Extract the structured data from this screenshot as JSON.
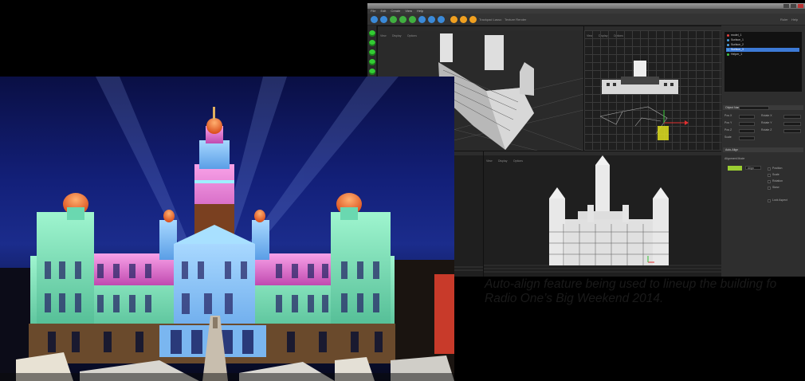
{
  "app": {
    "title_bar_text": "",
    "menus": [
      "File",
      "Edit",
      "Create",
      "View",
      "Help"
    ],
    "toolbar_labels": [
      "Trackpad Lasso",
      "Texture Render"
    ],
    "right_toolbar": [
      "Ruler",
      "Help"
    ],
    "viewport_headers": {
      "perspective": [
        "View",
        "Display",
        "Options"
      ],
      "top": [
        "View",
        "Display",
        "Options"
      ],
      "side": [
        "View",
        "Display",
        "Options"
      ],
      "front": [
        "View",
        "Display",
        "Options"
      ]
    },
    "layers": [
      {
        "name": "model_1",
        "color": "#e04040",
        "selected": false
      },
      {
        "name": "Surface_1",
        "color": "#4aa0e0",
        "selected": false
      },
      {
        "name": "Surface_2",
        "color": "#4aa0e0",
        "selected": false
      },
      {
        "name": "Surface_3",
        "color": "#4aa0e0",
        "selected": true
      },
      {
        "name": "Helper_1",
        "color": "#40c040",
        "selected": false
      }
    ],
    "properties": {
      "header": "Object Name",
      "object_name": "Surface_3",
      "fields_left": [
        "Pos X",
        "Pos Y",
        "Pos Z",
        "Scale"
      ],
      "fields_right": [
        "Rotate X",
        "Rotate Y",
        "Rotate Z"
      ],
      "section": "Auto-Align",
      "alignment_label": "Alignment Mode",
      "align_button": "Align",
      "options": [
        "Position",
        "Scale",
        "Rotation",
        "Skew"
      ],
      "extra_label": "Lock Aspect"
    }
  },
  "caption": {
    "line1": "Auto-align feature being used to lineup the building fo",
    "line2": "Radio One’s Big Weekend 2014."
  },
  "colors": {
    "building_green": "#7fe0b8",
    "building_pink": "#e87ad8",
    "building_blue": "#7ab6f0",
    "dome_orange": "#ff6a2a",
    "sky": "#13207a"
  }
}
